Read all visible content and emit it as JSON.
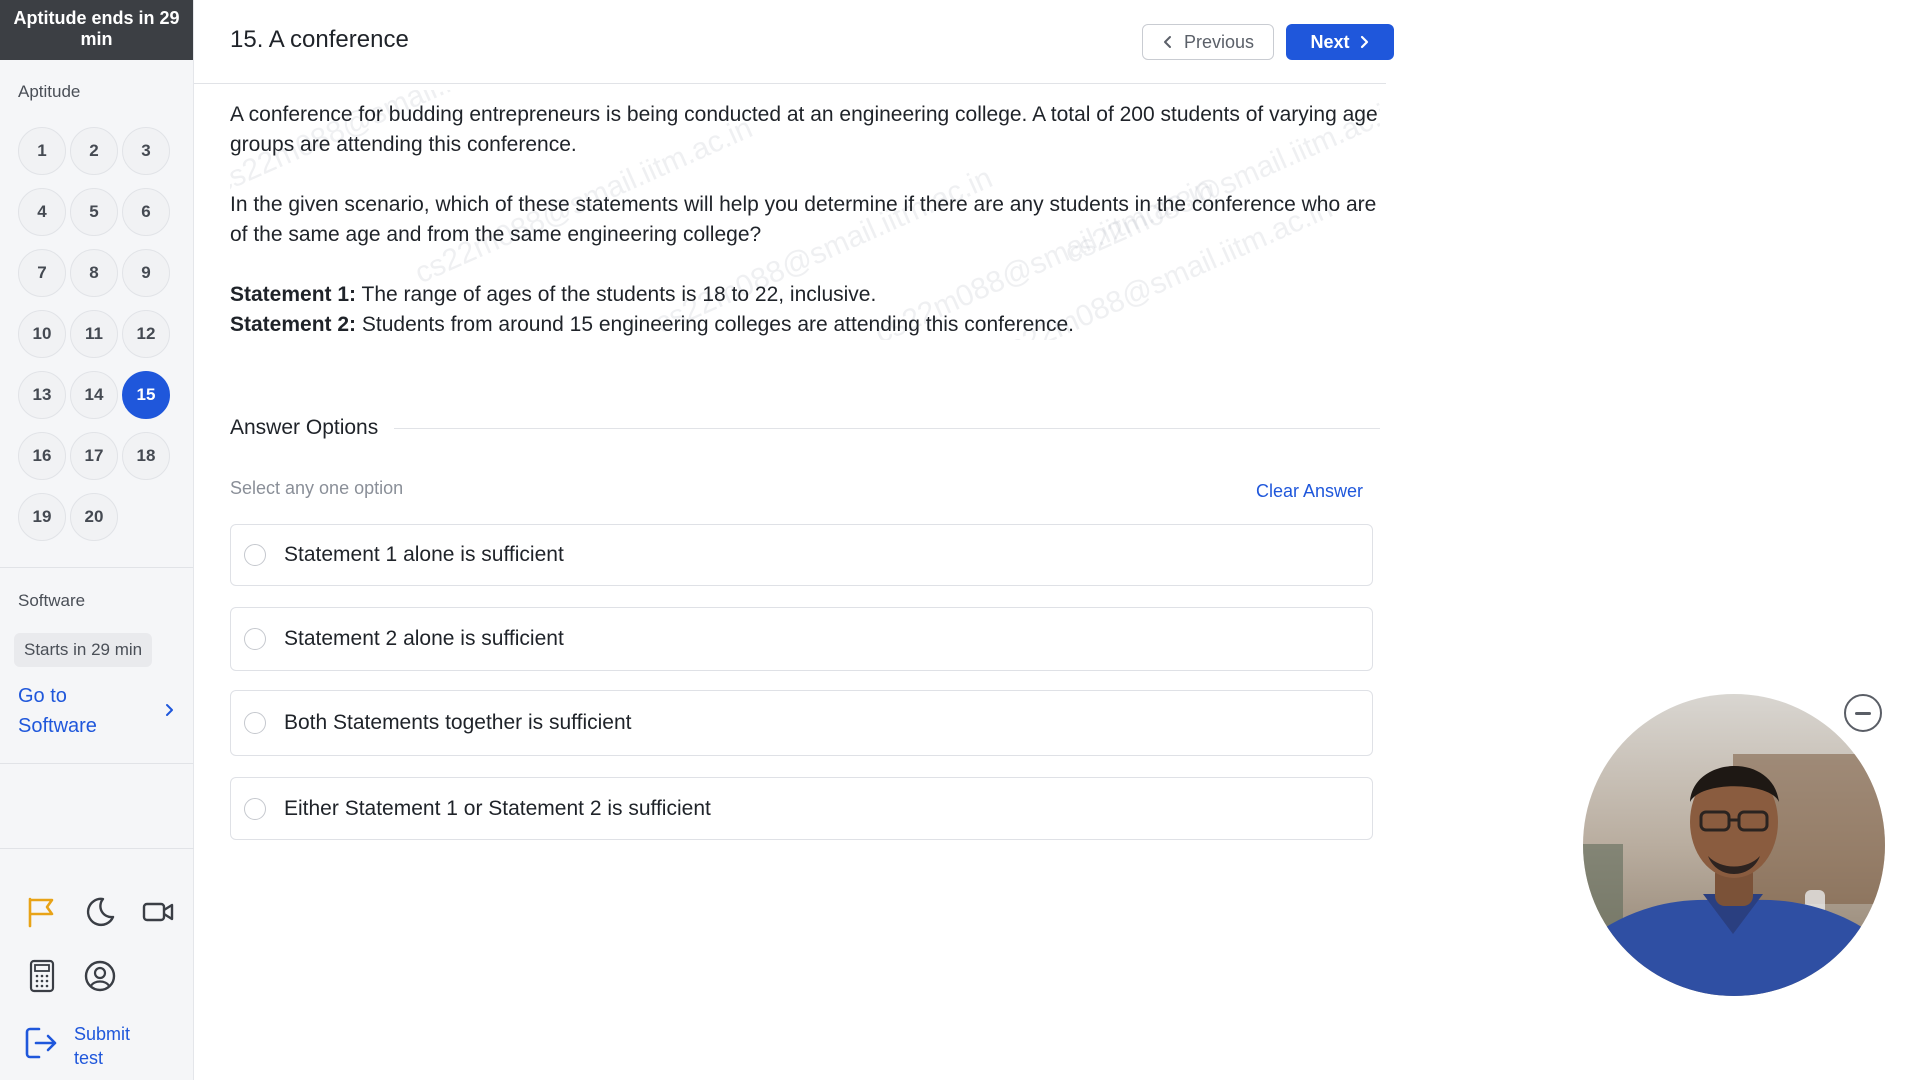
{
  "sidebar": {
    "timer_text": "Aptitude ends in 29 min",
    "aptitude_label": "Aptitude",
    "questions": [
      "1",
      "2",
      "3",
      "4",
      "5",
      "6",
      "7",
      "8",
      "9",
      "10",
      "11",
      "12",
      "13",
      "14",
      "15",
      "16",
      "17",
      "18",
      "19",
      "20"
    ],
    "active_question": "15",
    "software_label": "Software",
    "software_starts": "Starts in 29 min",
    "go_to_software": "Go to Software",
    "submit_label": "Submit test"
  },
  "header": {
    "question_title": "15. A conference",
    "previous_label": "Previous",
    "next_label": "Next"
  },
  "question": {
    "para1": "A conference for budding entrepreneurs is being conducted at an engineering college. A total of 200 students of varying age groups are attending this conference.",
    "para2": "In the given scenario, which of these statements will help you determine if there are any students in the conference who are of the same age and from the same engineering college?",
    "statement1_label": "Statement 1:",
    "statement1_text": " The range of ages of the students is 18 to 22, inclusive.",
    "statement2_label": "Statement 2:",
    "statement2_text": " Students from around 15 engineering colleges are attending this conference.",
    "watermark_text": "cs22m088@smail.iitm.ac.in"
  },
  "answers": {
    "title": "Answer Options",
    "hint": "Select any one option",
    "clear_label": "Clear Answer",
    "options": [
      "Statement 1 alone is sufficient",
      "Statement 2 alone is sufficient",
      "Both Statements together is sufficient",
      "Either Statement 1 or Statement 2 is sufficient"
    ]
  },
  "colors": {
    "accent": "#1f57db",
    "timer_bg": "#3c3f44",
    "flag_icon": "#e8a317"
  },
  "icons": {
    "flag": "flag-icon",
    "theme": "moon-icon",
    "camera": "video-camera-icon",
    "calculator": "calculator-icon",
    "profile": "user-circle-icon",
    "submit": "logout-icon",
    "minimize": "minimize-icon"
  }
}
